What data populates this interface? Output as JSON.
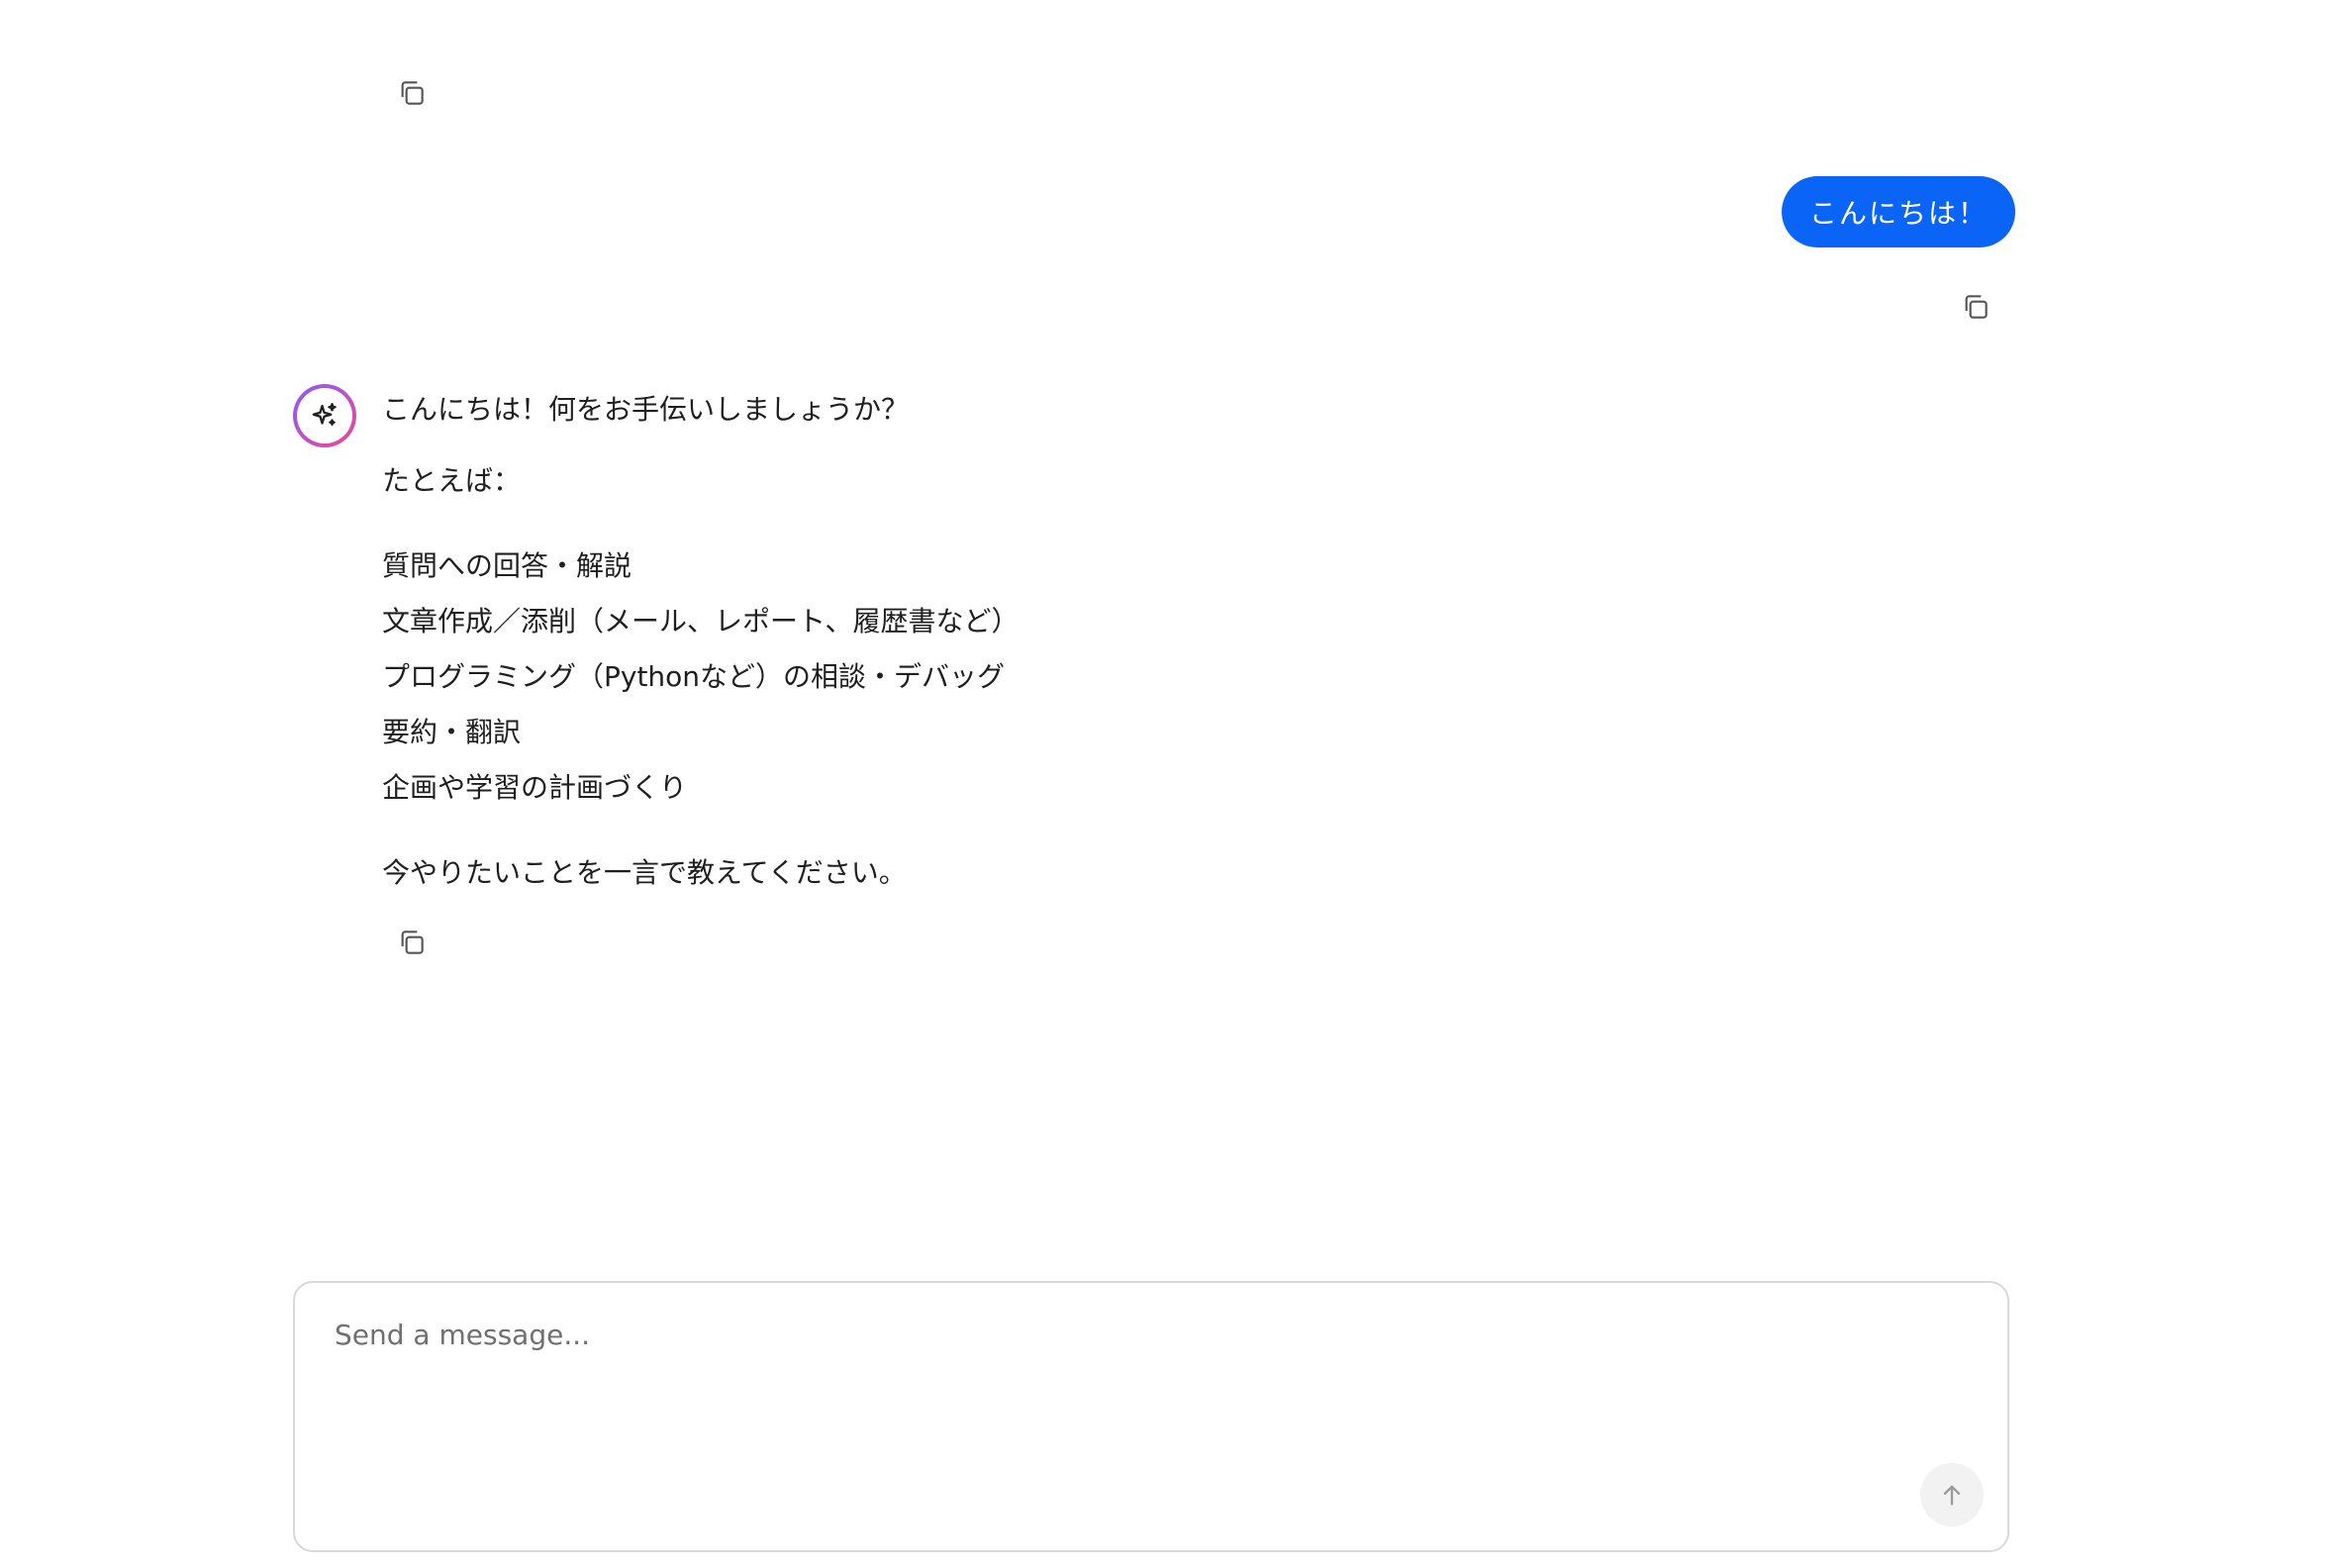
{
  "conversation": {
    "user_message": {
      "text": "こんにちは！"
    },
    "assistant_message": {
      "greeting": "こんにちは！何をお手伝いしましょうか？",
      "intro": "たとえば：",
      "items": [
        "質問への回答・解説",
        "文章作成／添削（メール、レポート、履歴書など）",
        "プログラミング（Pythonなど）の相談・デバッグ",
        "要約・翻訳",
        "企画や学習の計画づくり"
      ],
      "closing": "今やりたいことを一言で教えてください。"
    }
  },
  "composer": {
    "placeholder": "Send a message..."
  },
  "icons": {
    "copy": "copy-icon",
    "assistant_avatar": "sparkle-icon",
    "send": "arrow-up-icon"
  },
  "colors": {
    "user_bubble": "#0a64f5",
    "avatar_gradient_start": "#8a5cf6",
    "avatar_gradient_end": "#ec4899",
    "send_button_bg": "#f2f2f2"
  }
}
